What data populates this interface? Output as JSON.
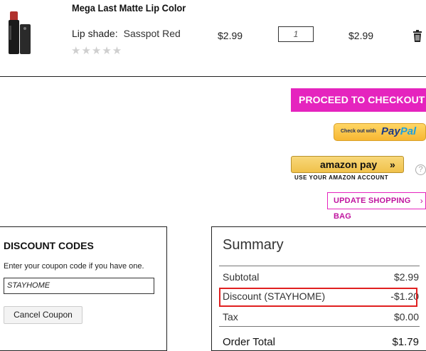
{
  "product": {
    "name": "Mega Last Matte Lip Color",
    "shade_label": "Lip shade:",
    "shade_value": "Sasspot Red",
    "rating_stars": "★★★★★",
    "price": "$2.99",
    "quantity": "1",
    "total": "$2.99"
  },
  "actions": {
    "checkout_label": "PROCEED TO CHECKOUT",
    "checkout_chev": "›",
    "paypal_small": "Check out with",
    "paypal_pay": "Pay",
    "paypal_pal": "Pal",
    "amazon_label": "amazon pay",
    "amazon_arrows": "»",
    "amazon_sub": "USE YOUR AMAZON ACCOUNT",
    "help": "?",
    "update_label": "UPDATE SHOPPING BAG",
    "update_chev": "›"
  },
  "discount": {
    "title": "DISCOUNT CODES",
    "instructions": "Enter your coupon code if you have one.",
    "coupon_value": "STAYHOME",
    "cancel_label": "Cancel Coupon"
  },
  "summary": {
    "title": "Summary",
    "rows": [
      {
        "label": "Subtotal",
        "value": "$2.99"
      },
      {
        "label": "Discount (STAYHOME)",
        "value": "-$1.20"
      },
      {
        "label": "Tax",
        "value": "$0.00"
      },
      {
        "label": "Order Total",
        "value": "$1.79"
      }
    ]
  },
  "colors": {
    "accent": "#e524be",
    "highlight": "#e02020"
  }
}
